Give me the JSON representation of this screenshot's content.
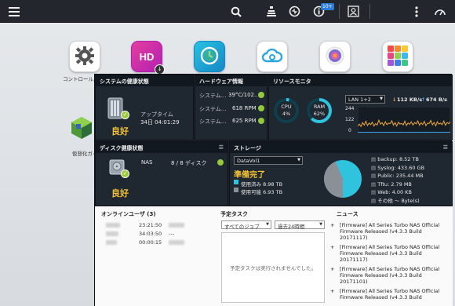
{
  "topbar": {
    "notification_count": "10+"
  },
  "desktop": {
    "apps": [
      {
        "label": "コントロールパ",
        "icon": "gear-icon"
      },
      {
        "label": "",
        "icon": "hd-station-icon"
      },
      {
        "label": "",
        "icon": "backup-clock-icon"
      },
      {
        "label": "",
        "icon": "cloud-icon"
      },
      {
        "label": "",
        "icon": "photo-app-icon"
      },
      {
        "label": "",
        "icon": "app-center-icon"
      },
      {
        "label": "仮想化ガイ",
        "icon": "virtualization-icon"
      }
    ]
  },
  "system_health": {
    "title": "システムの健康状態",
    "uptime_label": "アップタイム",
    "uptime_value": "34日 04:01:29",
    "status": "良好"
  },
  "hardware": {
    "title": "ハードウェア情報",
    "rows": [
      {
        "label": "システム...",
        "value": "39°C/102..."
      },
      {
        "label": "システム...",
        "value": "618 RPM"
      },
      {
        "label": "システム...",
        "value": "625 RPM"
      }
    ]
  },
  "resource": {
    "title": "リソースモニタ",
    "cpu_label": "CPU",
    "cpu_value": "4%",
    "cpu_pct": 4,
    "ram_label": "RAM",
    "ram_value": "62%",
    "ram_pct": 62,
    "lan_select": "LAN 1+2",
    "rx": "112 KB/s",
    "tx": "674 B/s",
    "y_ticks": [
      "244",
      "122",
      "0"
    ]
  },
  "disk_health": {
    "title": "ディスク健康状態",
    "nas_label": "NAS",
    "disk_count": "8 / 8 ディスク",
    "status": "良好"
  },
  "storage": {
    "title": "ストレージ",
    "volume_select": "DataVol1",
    "status": "準備完了",
    "used": "使用済み 8.98 TB",
    "free": "使用可能 6.93 TB",
    "used_fraction": 0.564,
    "legend": [
      "backup: 8.52 TB",
      "Syslog: 433.60 GB",
      "Public: 235.44 MB",
      "Tftu: 2.79 MB",
      "Web: 4.00 KB",
      "その他 ～ Byte(s)"
    ]
  },
  "online_users": {
    "title": "オンラインユーザ (3)",
    "rows": [
      {
        "time": "23:21:50",
        "extra": ""
      },
      {
        "time": "34:03:50",
        "extra": "---"
      },
      {
        "time": "00:00:15",
        "extra": ""
      }
    ]
  },
  "scheduled": {
    "title": "予定タスク",
    "job_select": "すべてのジョブ",
    "range_select": "過去24時間",
    "empty": "予定タスクは実行されませんでした。"
  },
  "news": {
    "title": "ニュース",
    "items": [
      "[Firmware] All Series Turbo NAS Official Firmware Released (v4.3.3 Build 20171117)",
      "[Firmware] All Series Turbo NAS Official Firmware Released (v4.3.3 Build 20171117)",
      "[Firmware] All Series Turbo NAS Official Firmware Released (v4.3.3 Build 20171101)",
      "[Firmware] All Series Turbo NAS Official Firmware Released (v4.3.3 Build"
    ]
  },
  "colors": {
    "accent": "#f1c232",
    "ok": "#95c93d",
    "ring": "#2fc3dd",
    "rx": "#f2a93b",
    "tx": "#3ea8f5"
  },
  "network_series": [
    60,
    80,
    55,
    95,
    70,
    110,
    65,
    90,
    75,
    100,
    60,
    85,
    70,
    120,
    80,
    95,
    65,
    105,
    75,
    90,
    85,
    115,
    70,
    95,
    60,
    100,
    80,
    88,
    72,
    110,
    66,
    92,
    78,
    104,
    70,
    96,
    82,
    112,
    68,
    94,
    76,
    108,
    64,
    90,
    86,
    118,
    72,
    98,
    62,
    104,
    80,
    90,
    74,
    112,
    68,
    96,
    84,
    106
  ]
}
